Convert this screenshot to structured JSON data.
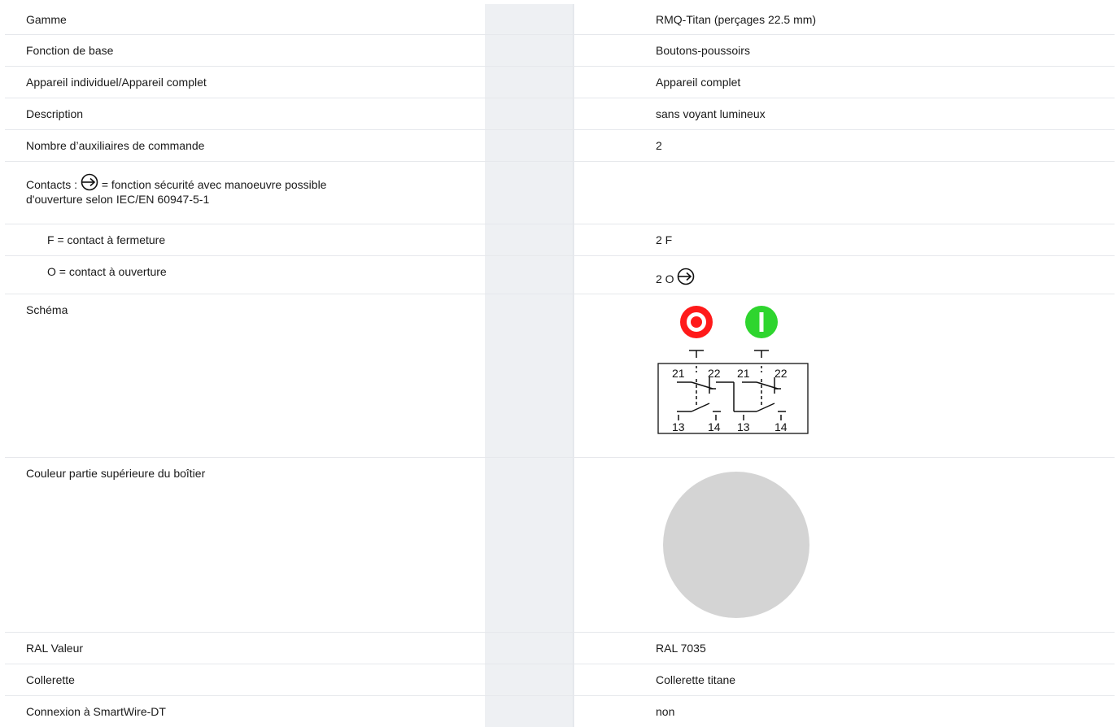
{
  "rows": {
    "gamme": {
      "label": "Gamme",
      "value": "RMQ-Titan (perçages 22.5 mm)"
    },
    "fonction": {
      "label": "Fonction de base",
      "value": "Boutons-poussoirs"
    },
    "appareil": {
      "label": "Appareil individuel/Appareil complet",
      "value": "Appareil complet"
    },
    "description": {
      "label": "Description",
      "value": "sans voyant lumineux"
    },
    "nombre": {
      "label": "Nombre d’auxiliaires de commande",
      "value": "2"
    },
    "contacts": {
      "label_prefix": "Contacts :",
      "label_suffix": "= fonction sécurité avec manoeuvre possible",
      "label_line2": "d'ouverture selon IEC/EN 60947-5-1",
      "icon": "positive-opening-icon"
    },
    "fermeture": {
      "label": "F = contact à fermeture",
      "value": "2 F"
    },
    "ouverture": {
      "label": "O = contact à ouverture",
      "value": "2 O",
      "icon": "positive-opening-icon"
    },
    "schema": {
      "label": "Schéma",
      "buttons": [
        {
          "symbol": "O",
          "color": "#ff1a1a"
        },
        {
          "symbol": "I",
          "color": "#2ed52e"
        }
      ],
      "terminals": [
        "21",
        "22",
        "21",
        "22",
        "13",
        "14",
        "13",
        "14"
      ]
    },
    "couleur": {
      "label": "Couleur partie supérieure du boîtier",
      "swatch_color": "#d4d4d4"
    },
    "ral": {
      "label": "RAL Valeur",
      "value": "RAL 7035"
    },
    "collerette": {
      "label": "Collerette",
      "value": "Collerette titane"
    },
    "smartwire": {
      "label": "Connexion à SmartWire-DT",
      "value": "non"
    }
  }
}
